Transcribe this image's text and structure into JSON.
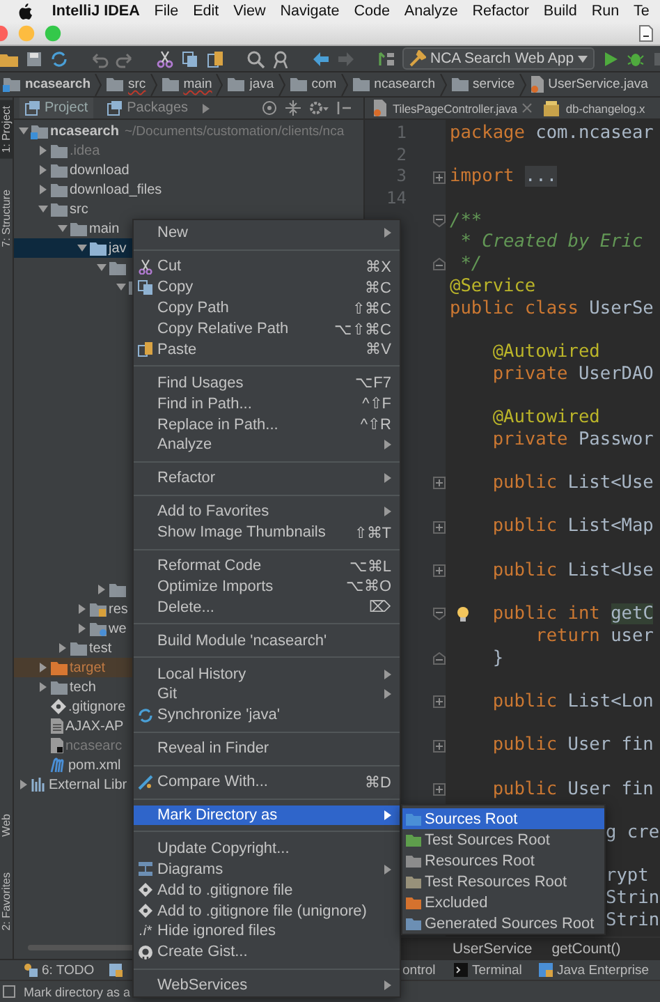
{
  "menubar": {
    "app": "IntelliJ IDEA",
    "items": [
      "File",
      "Edit",
      "View",
      "Navigate",
      "Code",
      "Analyze",
      "Refactor",
      "Build",
      "Run",
      "Te"
    ]
  },
  "toolbar": {
    "run_config": "NCA Search Web App"
  },
  "breadcrumbs": [
    {
      "kind": "module",
      "label": "ncasearch",
      "flagged": false
    },
    {
      "kind": "folder",
      "label": "src",
      "flagged": true
    },
    {
      "kind": "folder",
      "label": "main",
      "flagged": true
    },
    {
      "kind": "folder",
      "label": "java",
      "flagged": false
    },
    {
      "kind": "folder",
      "label": "com",
      "flagged": false
    },
    {
      "kind": "folder",
      "label": "ncasearch",
      "flagged": false
    },
    {
      "kind": "folder",
      "label": "service",
      "flagged": false
    },
    {
      "kind": "java",
      "label": "UserService.java",
      "flagged": false
    }
  ],
  "side_tools": {
    "top": [
      {
        "label": "1: Project",
        "selected": true
      },
      {
        "label": "7: Structure",
        "selected": false
      }
    ],
    "bottom": [
      {
        "label": "Web",
        "selected": false
      },
      {
        "label": "2: Favorites",
        "selected": false
      }
    ]
  },
  "project": {
    "tabs": [
      {
        "label": "Project",
        "selected": true
      },
      {
        "label": "Packages",
        "selected": false
      }
    ],
    "tree": [
      {
        "kind": "module",
        "label": "ncasearch",
        "path": "~/Documents/customation/clients/nca",
        "expanded": true,
        "selected": false,
        "children": [
          {
            "kind": "folder",
            "label": ".idea",
            "ignored": true,
            "expanded": false,
            "selected": false
          },
          {
            "kind": "folder",
            "label": "download",
            "expanded": false,
            "selected": false
          },
          {
            "kind": "folder",
            "label": "download_files",
            "expanded": false,
            "selected": false
          },
          {
            "kind": "folder",
            "label": "src",
            "expanded": true,
            "selected": false,
            "children": [
              {
                "kind": "folder",
                "label": "main",
                "expanded": true,
                "selected": false,
                "children": [
                  {
                    "kind": "source-folder",
                    "label": "jav",
                    "expanded": true,
                    "selected": true,
                    "children": [
                      {
                        "kind": "folder",
                        "expanded": true,
                        "selected": false,
                        "children": [
                          {
                            "kind": "folder",
                            "expanded": true,
                            "selected": false
                          }
                        ]
                      },
                      {
                        "kind": "folder",
                        "expanded": false,
                        "selected": false
                      }
                    ]
                  },
                  {
                    "kind": "resources-folder",
                    "label": "res",
                    "expanded": false,
                    "selected": false
                  },
                  {
                    "kind": "web-folder",
                    "label": "we",
                    "expanded": false,
                    "selected": false
                  }
                ]
              },
              {
                "kind": "folder",
                "label": "test",
                "expanded": false,
                "selected": false
              }
            ]
          },
          {
            "kind": "excluded-folder",
            "label": "target",
            "expanded": false,
            "selected": false
          },
          {
            "kind": "folder",
            "label": "tech",
            "expanded": false,
            "selected": false
          },
          {
            "kind": "gitignore",
            "label": ".gitignore",
            "selected": false
          },
          {
            "kind": "text-file",
            "label": "AJAX-AP",
            "selected": false
          },
          {
            "kind": "module-file",
            "label": "ncasearc",
            "ignored": true,
            "selected": false
          },
          {
            "kind": "maven-file",
            "label": "pom.xml",
            "selected": false
          }
        ]
      },
      {
        "kind": "library",
        "label": "External Libr",
        "expanded": false,
        "selected": false
      }
    ]
  },
  "editor": {
    "tabs": [
      {
        "kind": "java",
        "label": "TilesPageController.java"
      },
      {
        "kind": "xml",
        "label": "db-changelog.x"
      }
    ],
    "lines": [
      {
        "kind": "code",
        "number": "1",
        "tokens": [
          {
            "kind": "keyword",
            "text": "package"
          },
          {
            "kind": "plain",
            "text": " com.ncasear"
          }
        ]
      },
      {
        "kind": "blank",
        "number": "2"
      },
      {
        "kind": "code",
        "number": "3",
        "fold_collapsed": true,
        "tokens": [
          {
            "kind": "keyword",
            "text": "import "
          },
          {
            "kind": "folded",
            "text": "..."
          }
        ]
      },
      {
        "kind": "blank",
        "number": "14"
      },
      {
        "kind": "code",
        "fold_start": true,
        "tokens": [
          {
            "kind": "comment",
            "text": "/**"
          }
        ]
      },
      {
        "kind": "code",
        "tokens": [
          {
            "kind": "comment",
            "text": " * Created by Eric"
          }
        ]
      },
      {
        "kind": "code",
        "fold_end": true,
        "tokens": [
          {
            "kind": "comment",
            "text": " */"
          }
        ]
      },
      {
        "kind": "code",
        "tokens": [
          {
            "kind": "annotation",
            "text": "@Service"
          }
        ]
      },
      {
        "kind": "code",
        "tokens": [
          {
            "kind": "keyword",
            "text": "public class"
          },
          {
            "kind": "plain",
            "text": " UserSe"
          }
        ]
      },
      {
        "kind": "blank"
      },
      {
        "kind": "code",
        "tokens": [
          {
            "kind": "annotation",
            "text": "    @Autowired"
          }
        ]
      },
      {
        "kind": "code",
        "tokens": [
          {
            "kind": "keyword",
            "text": "    private"
          },
          {
            "kind": "plain",
            "text": " UserDAO"
          }
        ]
      },
      {
        "kind": "blank"
      },
      {
        "kind": "code",
        "tokens": [
          {
            "kind": "annotation",
            "text": "    @Autowired"
          }
        ]
      },
      {
        "kind": "code",
        "tokens": [
          {
            "kind": "keyword",
            "text": "    private"
          },
          {
            "kind": "plain",
            "text": " Passwor"
          }
        ]
      },
      {
        "kind": "blank"
      },
      {
        "kind": "code",
        "fold_collapsed": true,
        "tokens": [
          {
            "kind": "keyword",
            "text": "    public"
          },
          {
            "kind": "plain",
            "text": " List<Use"
          }
        ]
      },
      {
        "kind": "blank"
      },
      {
        "kind": "code",
        "fold_collapsed": true,
        "tokens": [
          {
            "kind": "keyword",
            "text": "    public"
          },
          {
            "kind": "plain",
            "text": " List<Map"
          }
        ]
      },
      {
        "kind": "blank"
      },
      {
        "kind": "code",
        "fold_collapsed": true,
        "tokens": [
          {
            "kind": "keyword",
            "text": "    public"
          },
          {
            "kind": "plain",
            "text": " List<Use"
          }
        ]
      },
      {
        "kind": "blank"
      },
      {
        "kind": "code",
        "fold_start": true,
        "bulb": true,
        "tokens": [
          {
            "kind": "keyword",
            "text": "    public int "
          },
          {
            "kind": "highlight",
            "text": "getC"
          }
        ]
      },
      {
        "kind": "code",
        "tokens": [
          {
            "kind": "keyword",
            "text": "        return"
          },
          {
            "kind": "plain",
            "text": " user"
          }
        ]
      },
      {
        "kind": "code",
        "fold_end": true,
        "tokens": [
          {
            "kind": "plain",
            "text": "    }"
          }
        ]
      },
      {
        "kind": "blank"
      },
      {
        "kind": "code",
        "fold_collapsed": true,
        "tokens": [
          {
            "kind": "keyword",
            "text": "    public"
          },
          {
            "kind": "plain",
            "text": " List<Lon"
          }
        ]
      },
      {
        "kind": "blank"
      },
      {
        "kind": "code",
        "fold_collapsed": true,
        "tokens": [
          {
            "kind": "keyword",
            "text": "    public"
          },
          {
            "kind": "plain",
            "text": " User fin"
          }
        ]
      },
      {
        "kind": "blank"
      },
      {
        "kind": "code",
        "fold_collapsed": true,
        "tokens": [
          {
            "kind": "keyword",
            "text": "    public"
          },
          {
            "kind": "plain",
            "text": " User fin"
          }
        ]
      },
      {
        "kind": "blank"
      },
      {
        "kind": "code",
        "clipped_start": true,
        "tokens": [
          {
            "kind": "plain",
            "text": "g cre"
          }
        ]
      },
      {
        "kind": "blank"
      },
      {
        "kind": "code",
        "clipped_start": true,
        "tokens": [
          {
            "kind": "plain",
            "text": "rypt"
          }
        ]
      },
      {
        "kind": "code",
        "clipped_start": true,
        "tokens": [
          {
            "kind": "plain",
            "text": "Strin"
          }
        ]
      },
      {
        "kind": "code",
        "clipped_start": true,
        "tokens": [
          {
            "kind": "plain",
            "text": "Strin"
          }
        ]
      }
    ],
    "footer": [
      "UserService",
      "getCount()"
    ]
  },
  "tool_windows": [
    {
      "kind": "todo",
      "label": "6: TODO"
    },
    {
      "kind": "app"
    },
    {
      "kind": "none",
      "label": "ontrol"
    },
    {
      "kind": "terminal",
      "label": "Terminal"
    },
    {
      "kind": "javaee",
      "label": "Java Enterprise"
    }
  ],
  "status": "Mark directory as a",
  "context_menu": {
    "items": [
      {
        "kind": "plain",
        "label": "New",
        "submenu": true,
        "selected": false
      },
      {
        "kind": "separator"
      },
      {
        "kind": "scissors",
        "label": "Cut",
        "shortcut": "⌘X",
        "selected": false
      },
      {
        "kind": "copy",
        "label": "Copy",
        "shortcut": "⌘C",
        "selected": false
      },
      {
        "kind": "plain",
        "label": "Copy Path",
        "shortcut": "⇧⌘C",
        "selected": false
      },
      {
        "kind": "plain",
        "label": "Copy Relative Path",
        "shortcut": "⌥⇧⌘C",
        "selected": false
      },
      {
        "kind": "paste",
        "label": "Paste",
        "shortcut": "⌘V",
        "selected": false
      },
      {
        "kind": "separator"
      },
      {
        "kind": "plain",
        "label": "Find Usages",
        "shortcut": "⌥F7",
        "selected": false
      },
      {
        "kind": "plain",
        "label": "Find in Path...",
        "shortcut": "^⇧F",
        "selected": false
      },
      {
        "kind": "plain",
        "label": "Replace in Path...",
        "shortcut": "^⇧R",
        "selected": false
      },
      {
        "kind": "plain",
        "label": "Analyze",
        "submenu": true,
        "selected": false
      },
      {
        "kind": "separator"
      },
      {
        "kind": "plain",
        "label": "Refactor",
        "submenu": true,
        "selected": false
      },
      {
        "kind": "separator"
      },
      {
        "kind": "plain",
        "label": "Add to Favorites",
        "submenu": true,
        "selected": false
      },
      {
        "kind": "plain",
        "label": "Show Image Thumbnails",
        "shortcut": "⇧⌘T",
        "selected": false
      },
      {
        "kind": "separator"
      },
      {
        "kind": "plain",
        "label": "Reformat Code",
        "shortcut": "⌥⌘L",
        "selected": false
      },
      {
        "kind": "plain",
        "label": "Optimize Imports",
        "shortcut": "⌥⌘O",
        "selected": false
      },
      {
        "kind": "plain",
        "label": "Delete...",
        "shortcut": "⌦",
        "selected": false
      },
      {
        "kind": "separator"
      },
      {
        "kind": "plain",
        "label": "Build Module 'ncasearch'",
        "selected": false
      },
      {
        "kind": "separator"
      },
      {
        "kind": "plain",
        "label": "Local History",
        "submenu": true,
        "selected": false
      },
      {
        "kind": "plain",
        "label": "Git",
        "submenu": true,
        "selected": false
      },
      {
        "kind": "sync",
        "label": "Synchronize 'java'",
        "selected": false
      },
      {
        "kind": "separator"
      },
      {
        "kind": "plain",
        "label": "Reveal in Finder",
        "selected": false
      },
      {
        "kind": "separator"
      },
      {
        "kind": "compare",
        "label": "Compare With...",
        "shortcut": "⌘D",
        "selected": false
      },
      {
        "kind": "separator"
      },
      {
        "kind": "plain",
        "label": "Mark Directory as",
        "submenu": true,
        "selected": true
      },
      {
        "kind": "separator"
      },
      {
        "kind": "plain",
        "label": "Update Copyright...",
        "selected": false
      },
      {
        "kind": "diagram",
        "label": "Diagrams",
        "submenu": true,
        "selected": false
      },
      {
        "kind": "git",
        "label": "Add to .gitignore file",
        "selected": false
      },
      {
        "kind": "git",
        "label": "Add to .gitignore file (unignore)",
        "selected": false
      },
      {
        "kind": "text-icon",
        "icon_text": ".i*",
        "label": "Hide ignored files",
        "selected": false
      },
      {
        "kind": "github",
        "label": "Create Gist...",
        "selected": false
      },
      {
        "kind": "separator"
      },
      {
        "kind": "plain",
        "label": "WebServices",
        "submenu": true,
        "selected": false
      }
    ]
  },
  "submenu": {
    "items": [
      {
        "kind": "folder",
        "label": "Sources Root",
        "color": "#4a8fd6",
        "selected": true
      },
      {
        "kind": "folder",
        "label": "Test Sources Root",
        "color": "#5e9e4c",
        "selected": false
      },
      {
        "kind": "folder",
        "label": "Resources Root",
        "color": "#8c8c8c",
        "selected": false
      },
      {
        "kind": "folder",
        "label": "Test Resources Root",
        "color": "#98917a",
        "selected": false
      },
      {
        "kind": "folder",
        "label": "Excluded",
        "color": "#d5722e",
        "selected": false
      },
      {
        "kind": "folder",
        "label": "Generated Sources Root",
        "color": "#6c8fb4",
        "selected": false
      }
    ]
  }
}
